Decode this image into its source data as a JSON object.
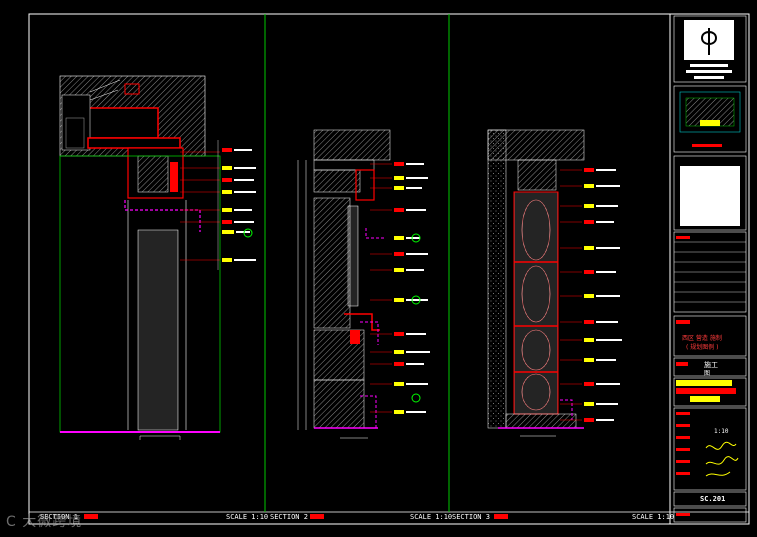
{
  "sections": [
    {
      "title": "SECTION 1",
      "scale": "SCALE 1:10"
    },
    {
      "title": "SECTION 2",
      "scale": "SCALE 1:10"
    },
    {
      "title": "SECTION 3",
      "scale": "SCALE 1:10"
    }
  ],
  "title_block": {
    "chinese_title": "西区 营造 施制",
    "chinese_subtitle": "( 规划图例 )",
    "stage": "施工",
    "stage_sub": "图",
    "scale_value": "1:10",
    "drawing_number": "SC.201"
  },
  "watermark": "C 大微跨境",
  "colors": {
    "background": "#000000",
    "frame": "#ffffff",
    "section_divider": "#00c800",
    "accent_red": "#ff0000",
    "accent_magenta": "#ff00ff",
    "accent_yellow": "#ffff00",
    "hatch_gray": "#8a8a8a"
  },
  "icons": [
    "logo-icon",
    "key-plan-icon",
    "signature-icon"
  ]
}
